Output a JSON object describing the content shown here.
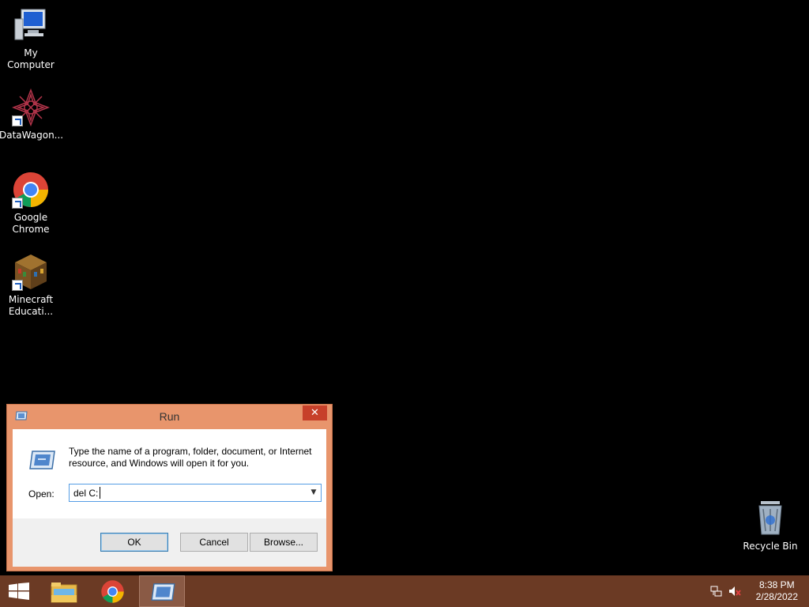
{
  "desktop": {
    "icons": [
      {
        "label": "My Computer",
        "icon": "computer-icon"
      },
      {
        "label": "DataWagon...",
        "icon": "datawagon-icon"
      },
      {
        "label": "Google Chrome",
        "icon": "chrome-icon"
      },
      {
        "label": "Minecraft Educati...",
        "icon": "minecraft-icon"
      },
      {
        "label": "Recycle Bin",
        "icon": "recycle-bin-icon"
      }
    ]
  },
  "run_dialog": {
    "title": "Run",
    "close_glyph": "✕",
    "description": "Type the name of a program, folder, document, or Internet resource, and Windows will open it for you.",
    "open_label": "Open:",
    "open_value": "del C:",
    "ok_label": "OK",
    "cancel_label": "Cancel",
    "browse_label": "Browse..."
  },
  "taskbar": {
    "items": [
      "start-icon",
      "file-explorer-icon",
      "chrome-icon",
      "run-icon"
    ],
    "time": "8:38 PM",
    "date": "2/28/2022"
  },
  "colors": {
    "accent": "#e8956c",
    "taskbar": "#6b3a24",
    "close": "#c7402a"
  }
}
